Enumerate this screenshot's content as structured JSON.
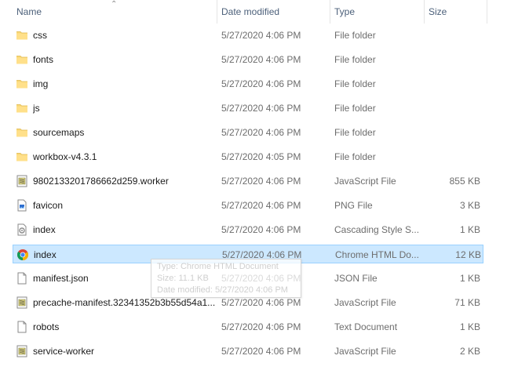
{
  "columns": {
    "name": "Name",
    "date": "Date modified",
    "type": "Type",
    "size": "Size"
  },
  "files": [
    {
      "name": "css",
      "date": "5/27/2020 4:06 PM",
      "type": "File folder",
      "size": "",
      "icon": "folder-icon"
    },
    {
      "name": "fonts",
      "date": "5/27/2020 4:06 PM",
      "type": "File folder",
      "size": "",
      "icon": "folder-icon"
    },
    {
      "name": "img",
      "date": "5/27/2020 4:06 PM",
      "type": "File folder",
      "size": "",
      "icon": "folder-icon"
    },
    {
      "name": "js",
      "date": "5/27/2020 4:06 PM",
      "type": "File folder",
      "size": "",
      "icon": "folder-icon"
    },
    {
      "name": "sourcemaps",
      "date": "5/27/2020 4:06 PM",
      "type": "File folder",
      "size": "",
      "icon": "folder-icon"
    },
    {
      "name": "workbox-v4.3.1",
      "date": "5/27/2020 4:05 PM",
      "type": "File folder",
      "size": "",
      "icon": "folder-icon"
    },
    {
      "name": "9802133201786662d259.worker",
      "date": "5/27/2020 4:06 PM",
      "type": "JavaScript File",
      "size": "855 KB",
      "icon": "javascript-file-icon"
    },
    {
      "name": "favicon",
      "date": "5/27/2020 4:06 PM",
      "type": "PNG File",
      "size": "3 KB",
      "icon": "png-file-icon"
    },
    {
      "name": "index",
      "date": "5/27/2020 4:06 PM",
      "type": "Cascading Style S...",
      "size": "1 KB",
      "icon": "css-file-icon"
    },
    {
      "name": "index",
      "date": "5/27/2020 4:06 PM",
      "type": "Chrome HTML Do...",
      "size": "12 KB",
      "icon": "chrome-icon"
    },
    {
      "name": "manifest.json",
      "date": "5/27/2020 4:06 PM",
      "type": "JSON File",
      "size": "1 KB",
      "icon": "blank-file-icon"
    },
    {
      "name": "precache-manifest.32341352b3b55d54a1...",
      "date": "5/27/2020 4:06 PM",
      "type": "JavaScript File",
      "size": "71 KB",
      "icon": "javascript-file-icon"
    },
    {
      "name": "robots",
      "date": "5/27/2020 4:06 PM",
      "type": "Text Document",
      "size": "1 KB",
      "icon": "blank-file-icon"
    },
    {
      "name": "service-worker",
      "date": "5/27/2020 4:06 PM",
      "type": "JavaScript File",
      "size": "2 KB",
      "icon": "javascript-file-icon"
    }
  ],
  "selected_index": 9,
  "tooltip": {
    "type": "Type: Chrome HTML Document",
    "size": "Size: 11.1 KB",
    "date": "Date modified: 5/27/2020 4:06 PM"
  },
  "colors": {
    "selection": "#cce8ff",
    "selection_border": "#99d1ff",
    "header_text": "#4c607a",
    "folder": "#f8d775"
  }
}
